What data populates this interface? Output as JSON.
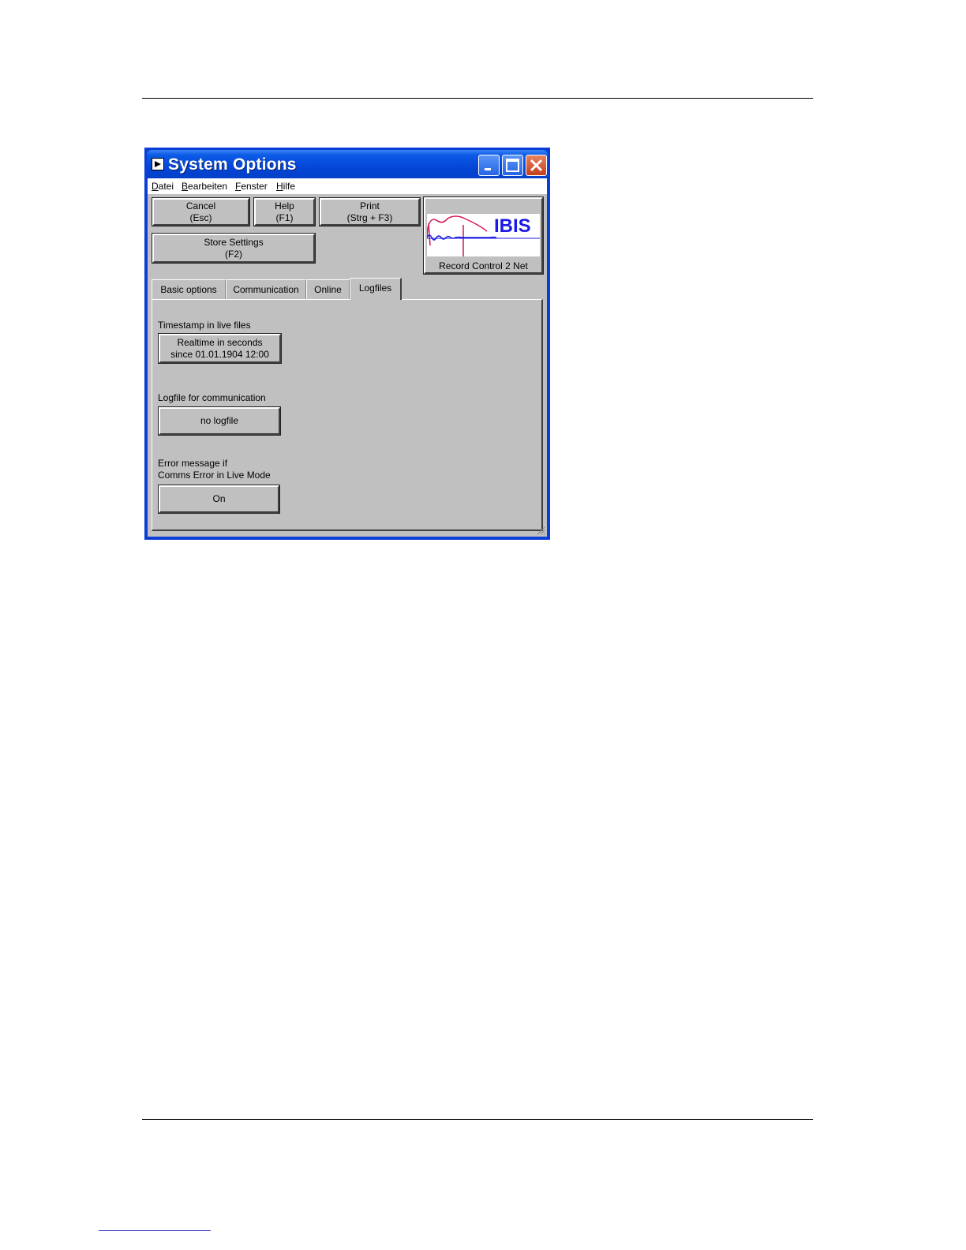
{
  "window": {
    "title": "System Options"
  },
  "menu": {
    "items": [
      "Datei",
      "Bearbeiten",
      "Fenster",
      "Hilfe"
    ]
  },
  "toolbar": {
    "cancel": {
      "line1": "Cancel",
      "line2": "(Esc)"
    },
    "help": {
      "line1": "Help",
      "line2": "(F1)"
    },
    "print": {
      "line1": "Print",
      "line2": "(Strg + F3)"
    },
    "store": {
      "line1": "Store Settings",
      "line2": "(F2)"
    }
  },
  "logo": {
    "brand": "IBIS",
    "caption": "Record Control 2 Net"
  },
  "tabs": [
    {
      "label": "Basic options"
    },
    {
      "label": "Communication"
    },
    {
      "label": "Online"
    },
    {
      "label": "Logfiles"
    }
  ],
  "active_tab": "Logfiles",
  "logfiles": {
    "timestamp": {
      "label": "Timestamp in live files",
      "line1": "Realtime in seconds",
      "line2": "since 01.01.1904 12:00"
    },
    "comm_logfile": {
      "label": "Logfile for communication",
      "value": "no logfile"
    },
    "error_message": {
      "label_line1": "Error message if",
      "label_line2": "Comms Error in Live Mode",
      "value": "On"
    }
  },
  "colors": {
    "titlebar": "#0546d8",
    "client_bg": "#c0c0c0",
    "logo_text": "#1a1ae6",
    "logo_curve": "#d4145a"
  },
  "icons": [
    "app-icon",
    "minimize-icon",
    "maximize-icon",
    "close-icon",
    "resize-grip-icon"
  ]
}
